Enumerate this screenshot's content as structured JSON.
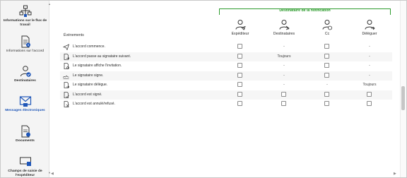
{
  "sidebar": {
    "items": [
      {
        "label": "Informations sur le flux de travail",
        "icon": "workflow-icon",
        "active": false,
        "bold": true
      },
      {
        "label": "Informations sur l'accord",
        "icon": "agreement-info-icon",
        "active": false,
        "bold": false
      },
      {
        "label": "Destinataires",
        "icon": "recipients-icon",
        "active": false,
        "bold": true
      },
      {
        "label": "Messages électroniques",
        "icon": "email-messages-icon",
        "active": true,
        "bold": true
      },
      {
        "label": "Documents",
        "icon": "documents-icon",
        "active": false,
        "bold": true
      },
      {
        "label": "Champs de saisie de l'expéditeur",
        "icon": "sender-fields-icon",
        "active": false,
        "bold": true
      }
    ]
  },
  "group_title": "Destinataire de la notification",
  "events_header": "Événements",
  "columns": [
    {
      "label": "Expéditeur",
      "icon": "sender-icon"
    },
    {
      "label": "Destinataires",
      "icon": "recipient-icon"
    },
    {
      "label": "Cc",
      "icon": "cc-icon"
    },
    {
      "label": "Déléguer",
      "icon": "delegate-icon"
    }
  ],
  "rows": [
    {
      "event": "L'accord commence.",
      "icon": "send-icon",
      "cells": [
        "checkbox",
        "-",
        "checkbox",
        "-"
      ]
    },
    {
      "event": "L'accord passe au signataire suivant.",
      "icon": "document-arrow-icon",
      "cells": [
        "checkbox",
        "Toujours",
        "checkbox",
        "-"
      ]
    },
    {
      "event": "Le signataire affiche l'invitation.",
      "icon": "view-icon",
      "cells": [
        "checkbox",
        "-",
        "checkbox",
        "-"
      ]
    },
    {
      "event": "Le signataire signe.",
      "icon": "signature-icon",
      "cells": [
        "checkbox",
        "-",
        "checkbox",
        "-"
      ]
    },
    {
      "event": "Le signataire délègue.",
      "icon": "delegate-doc-icon",
      "cells": [
        "checkbox",
        "-",
        "-",
        "Toujours"
      ]
    },
    {
      "event": "L'accord est signé.",
      "icon": "signed-doc-icon",
      "cells": [
        "checkbox",
        "checkbox",
        "checkbox",
        "checkbox"
      ]
    },
    {
      "event": "L'accord est annulé/refusé.",
      "icon": "cancelled-doc-icon",
      "cells": [
        "checkbox",
        "checkbox",
        "checkbox",
        "checkbox"
      ]
    }
  ],
  "colors": {
    "accent": "#1f56b8",
    "group": "#2d9b2d"
  }
}
